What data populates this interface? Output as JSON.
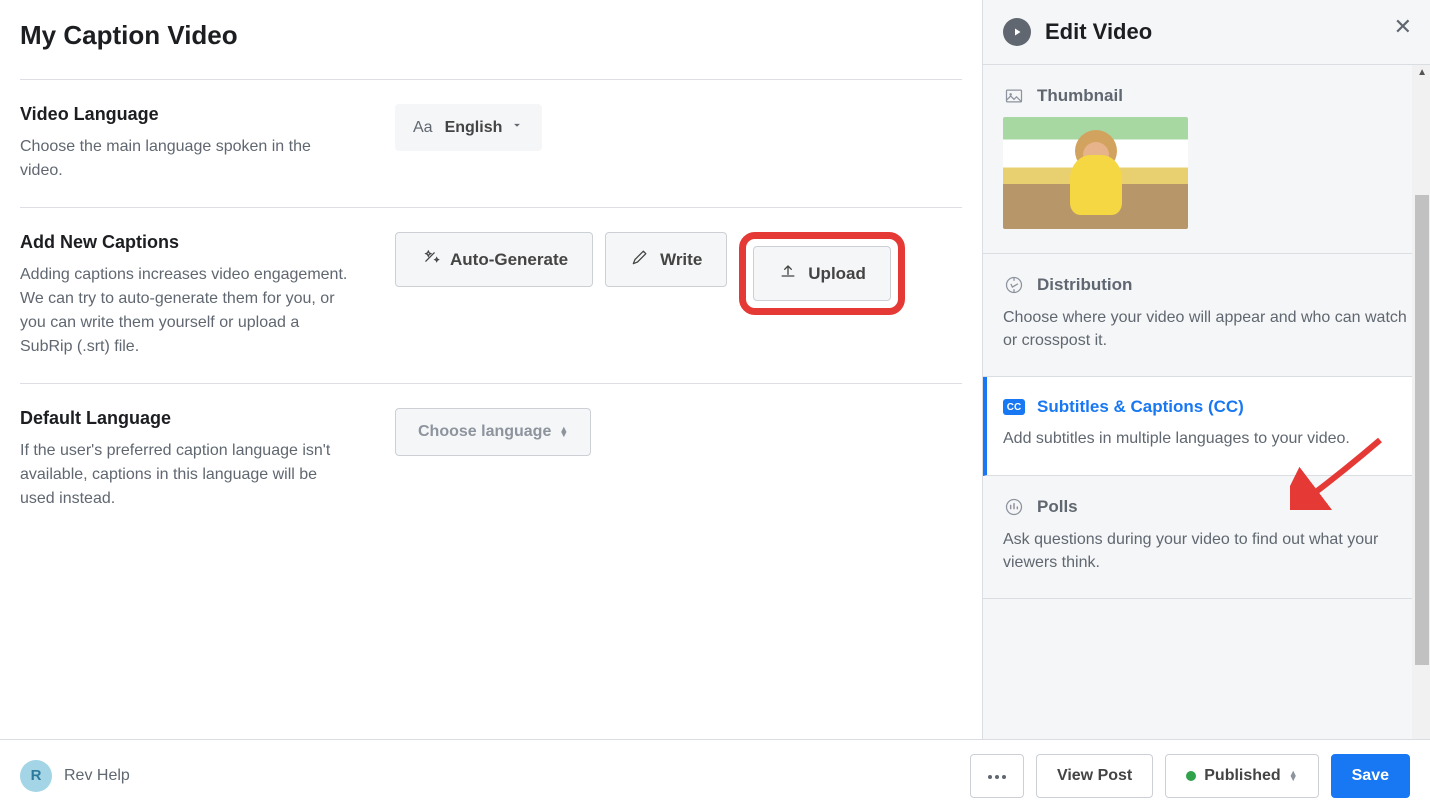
{
  "page_title": "My Caption Video",
  "sections": {
    "video_language": {
      "heading": "Video Language",
      "desc": "Choose the main language spoken in the video.",
      "selected": "English",
      "prefix": "Aa"
    },
    "add_captions": {
      "heading": "Add New Captions",
      "desc": "Adding captions increases video engagement. We can try to auto-generate them for you, or you can write them yourself or upload a SubRip (.srt) file.",
      "buttons": {
        "auto": "Auto-Generate",
        "write": "Write",
        "upload": "Upload"
      }
    },
    "default_language": {
      "heading": "Default Language",
      "desc": "If the user's preferred caption language isn't available, captions in this language will be used instead.",
      "placeholder": "Choose language"
    }
  },
  "sidebar": {
    "title": "Edit Video",
    "thumbnail": {
      "label": "Thumbnail"
    },
    "distribution": {
      "label": "Distribution",
      "desc": "Choose where your video will appear and who can watch or crosspost it."
    },
    "subtitles": {
      "label": "Subtitles & Captions (CC)",
      "desc": "Add subtitles in multiple languages to your video.",
      "badge": "CC"
    },
    "polls": {
      "label": "Polls",
      "desc": "Ask questions during your video to find out what your viewers think."
    }
  },
  "footer": {
    "avatar_letter": "R",
    "account": "Rev Help",
    "view_post": "View Post",
    "published": "Published",
    "save": "Save"
  }
}
